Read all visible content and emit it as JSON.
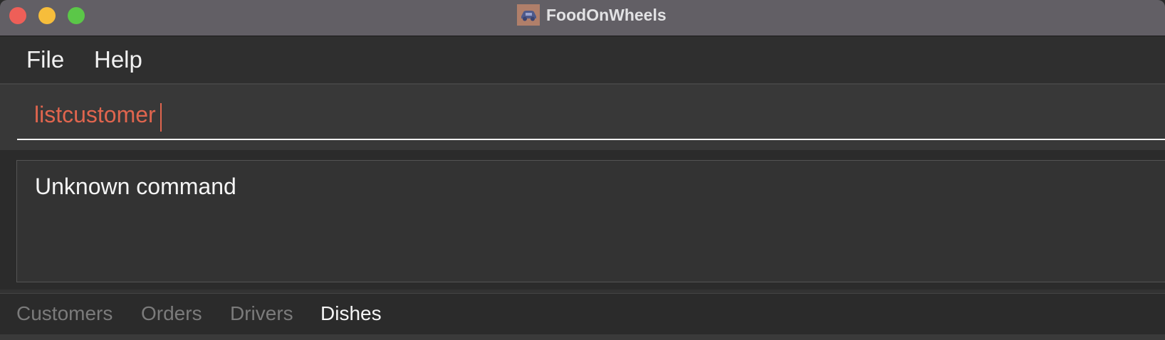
{
  "window": {
    "title": "FoodOnWheels",
    "app_icon": "car-icon",
    "controls": [
      "close",
      "minimize",
      "maximize"
    ]
  },
  "menu": {
    "items": [
      {
        "label": "File"
      },
      {
        "label": "Help"
      }
    ]
  },
  "command_box": {
    "value": "listcustomer",
    "text_color": "#e0654e"
  },
  "result_display": {
    "text": "Unknown command"
  },
  "tabs": [
    {
      "label": "Customers",
      "active": false
    },
    {
      "label": "Orders",
      "active": false
    },
    {
      "label": "Drivers",
      "active": false
    },
    {
      "label": "Dishes",
      "active": true
    }
  ],
  "colors": {
    "titlebar": "#625f65",
    "background": "#333333",
    "accent_error": "#e0654e",
    "close": "#ee5f58",
    "minimize": "#f6bd3b",
    "maximize": "#5bc748"
  }
}
